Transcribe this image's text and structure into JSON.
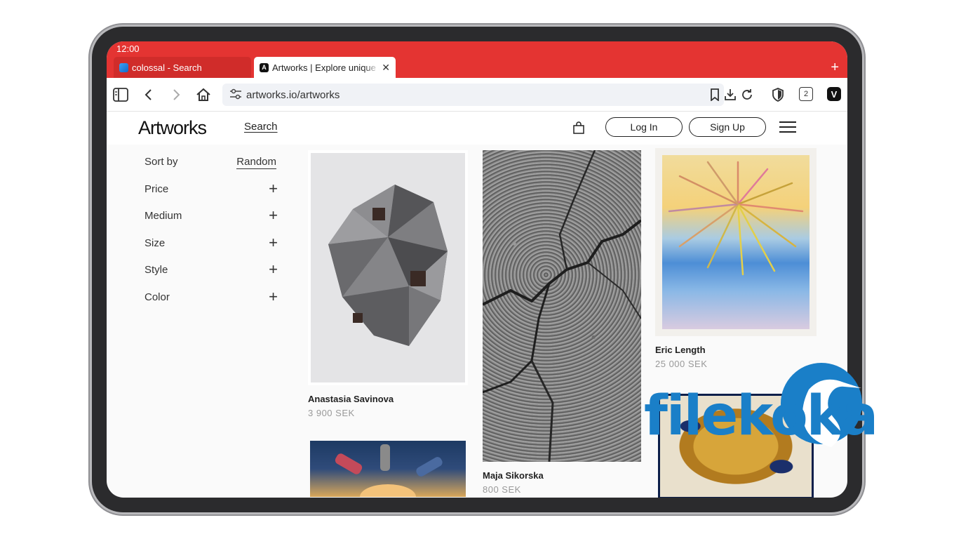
{
  "status_bar": {
    "time": "12:00"
  },
  "tabs": [
    {
      "title": "colossal - Search",
      "favicon": "bing-icon",
      "active": false
    },
    {
      "title": "Artworks | Explore unique a",
      "favicon": "artworks-favicon",
      "active": true
    }
  ],
  "toolbar": {
    "url": "artworks.io/artworks",
    "tab_count": "2",
    "icons": [
      "sidebar-icon",
      "back-icon",
      "forward-icon",
      "home-icon",
      "site-settings-icon",
      "bookmark-icon",
      "download-icon",
      "reload-icon",
      "shield-icon",
      "tabs-icon",
      "vivaldi-menu-icon"
    ]
  },
  "site": {
    "logo": "Artworks",
    "nav_search": "Search",
    "login": "Log In",
    "signup": "Sign Up"
  },
  "filters": {
    "sort_label": "Sort by",
    "sort_value": "Random",
    "items": [
      "Price",
      "Medium",
      "Size",
      "Style",
      "Color"
    ]
  },
  "artworks": [
    {
      "artist": "Anastasia Savinova",
      "price": "3 900 SEK"
    },
    {
      "artist": "Maja Sikorska",
      "price": "800 SEK"
    },
    {
      "artist": "Eric Length",
      "price": "25 000 SEK"
    }
  ],
  "watermark": {
    "text": "filekoka"
  },
  "colors": {
    "browser_red": "#e43432",
    "watermark_blue": "#1a7fc8"
  }
}
